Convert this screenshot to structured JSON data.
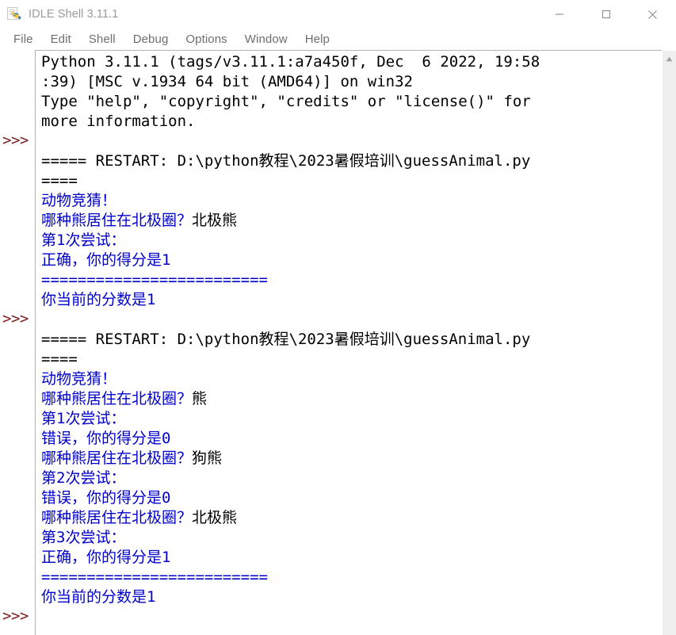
{
  "window": {
    "title": "IDLE Shell 3.11.1",
    "icon": "python-file-icon",
    "controls": {
      "minimize": "minimize-icon",
      "maximize": "maximize-icon",
      "close": "close-icon"
    }
  },
  "menubar": {
    "items": [
      {
        "label": "File"
      },
      {
        "label": "Edit"
      },
      {
        "label": "Shell"
      },
      {
        "label": "Debug"
      },
      {
        "label": "Options"
      },
      {
        "label": "Window"
      },
      {
        "label": "Help"
      }
    ]
  },
  "shell": {
    "prompt": ">>>",
    "prompt_color": "#7d2020",
    "output_color": "#0000cc",
    "input_color": "#000000",
    "scrollbar": {
      "up_arrow": "scroll-up-arrow-icon"
    },
    "lines": [
      {
        "segments": [
          {
            "text": "Python 3.11.1 (tags/v3.11.1:a7a450f, Dec  6 2022, 19:58",
            "color": "black"
          }
        ]
      },
      {
        "segments": [
          {
            "text": ":39) [MSC v.1934 64 bit (AMD64)] on win32",
            "color": "black"
          }
        ]
      },
      {
        "segments": [
          {
            "text": "Type \"help\", \"copyright\", \"credits\" or \"license()\" for",
            "color": "black"
          }
        ]
      },
      {
        "segments": [
          {
            "text": "more information.",
            "color": "black"
          }
        ]
      },
      {
        "prompt": true,
        "segments": [
          {
            "text": "",
            "color": "black"
          }
        ]
      },
      {
        "segments": [
          {
            "text": "===== RESTART: D:\\python教程\\2023暑假培训\\guessAnimal.py",
            "color": "black"
          }
        ]
      },
      {
        "segments": [
          {
            "text": "====",
            "color": "black"
          }
        ]
      },
      {
        "segments": [
          {
            "text": "动物竞猜！",
            "color": "blue"
          }
        ]
      },
      {
        "segments": [
          {
            "text": "哪种熊居住在北极圈？",
            "color": "blue"
          },
          {
            "text": "北极熊",
            "color": "black"
          }
        ]
      },
      {
        "segments": [
          {
            "text": "第1次尝试：",
            "color": "blue"
          }
        ]
      },
      {
        "segments": [
          {
            "text": "正确，你的得分是1",
            "color": "blue"
          }
        ]
      },
      {
        "segments": [
          {
            "text": "=========================",
            "color": "blue"
          }
        ]
      },
      {
        "segments": [
          {
            "text": "你当前的分数是1",
            "color": "blue"
          }
        ]
      },
      {
        "prompt": true,
        "segments": [
          {
            "text": "",
            "color": "black"
          }
        ]
      },
      {
        "segments": [
          {
            "text": "===== RESTART: D:\\python教程\\2023暑假培训\\guessAnimal.py",
            "color": "black"
          }
        ]
      },
      {
        "segments": [
          {
            "text": "====",
            "color": "black"
          }
        ]
      },
      {
        "segments": [
          {
            "text": "动物竞猜！",
            "color": "blue"
          }
        ]
      },
      {
        "segments": [
          {
            "text": "哪种熊居住在北极圈？",
            "color": "blue"
          },
          {
            "text": "熊",
            "color": "black"
          }
        ]
      },
      {
        "segments": [
          {
            "text": "第1次尝试：",
            "color": "blue"
          }
        ]
      },
      {
        "segments": [
          {
            "text": "错误，你的得分是0",
            "color": "blue"
          }
        ]
      },
      {
        "segments": [
          {
            "text": "哪种熊居住在北极圈？",
            "color": "blue"
          },
          {
            "text": "狗熊",
            "color": "black"
          }
        ]
      },
      {
        "segments": [
          {
            "text": "第2次尝试：",
            "color": "blue"
          }
        ]
      },
      {
        "segments": [
          {
            "text": "错误，你的得分是0",
            "color": "blue"
          }
        ]
      },
      {
        "segments": [
          {
            "text": "哪种熊居住在北极圈？",
            "color": "blue"
          },
          {
            "text": "北极熊",
            "color": "black"
          }
        ]
      },
      {
        "segments": [
          {
            "text": "第3次尝试：",
            "color": "blue"
          }
        ]
      },
      {
        "segments": [
          {
            "text": "正确，你的得分是1",
            "color": "blue"
          }
        ]
      },
      {
        "segments": [
          {
            "text": "=========================",
            "color": "blue"
          }
        ]
      },
      {
        "segments": [
          {
            "text": "你当前的分数是1",
            "color": "blue"
          }
        ]
      },
      {
        "prompt": true,
        "segments": [
          {
            "text": "",
            "color": "black"
          }
        ]
      }
    ]
  }
}
